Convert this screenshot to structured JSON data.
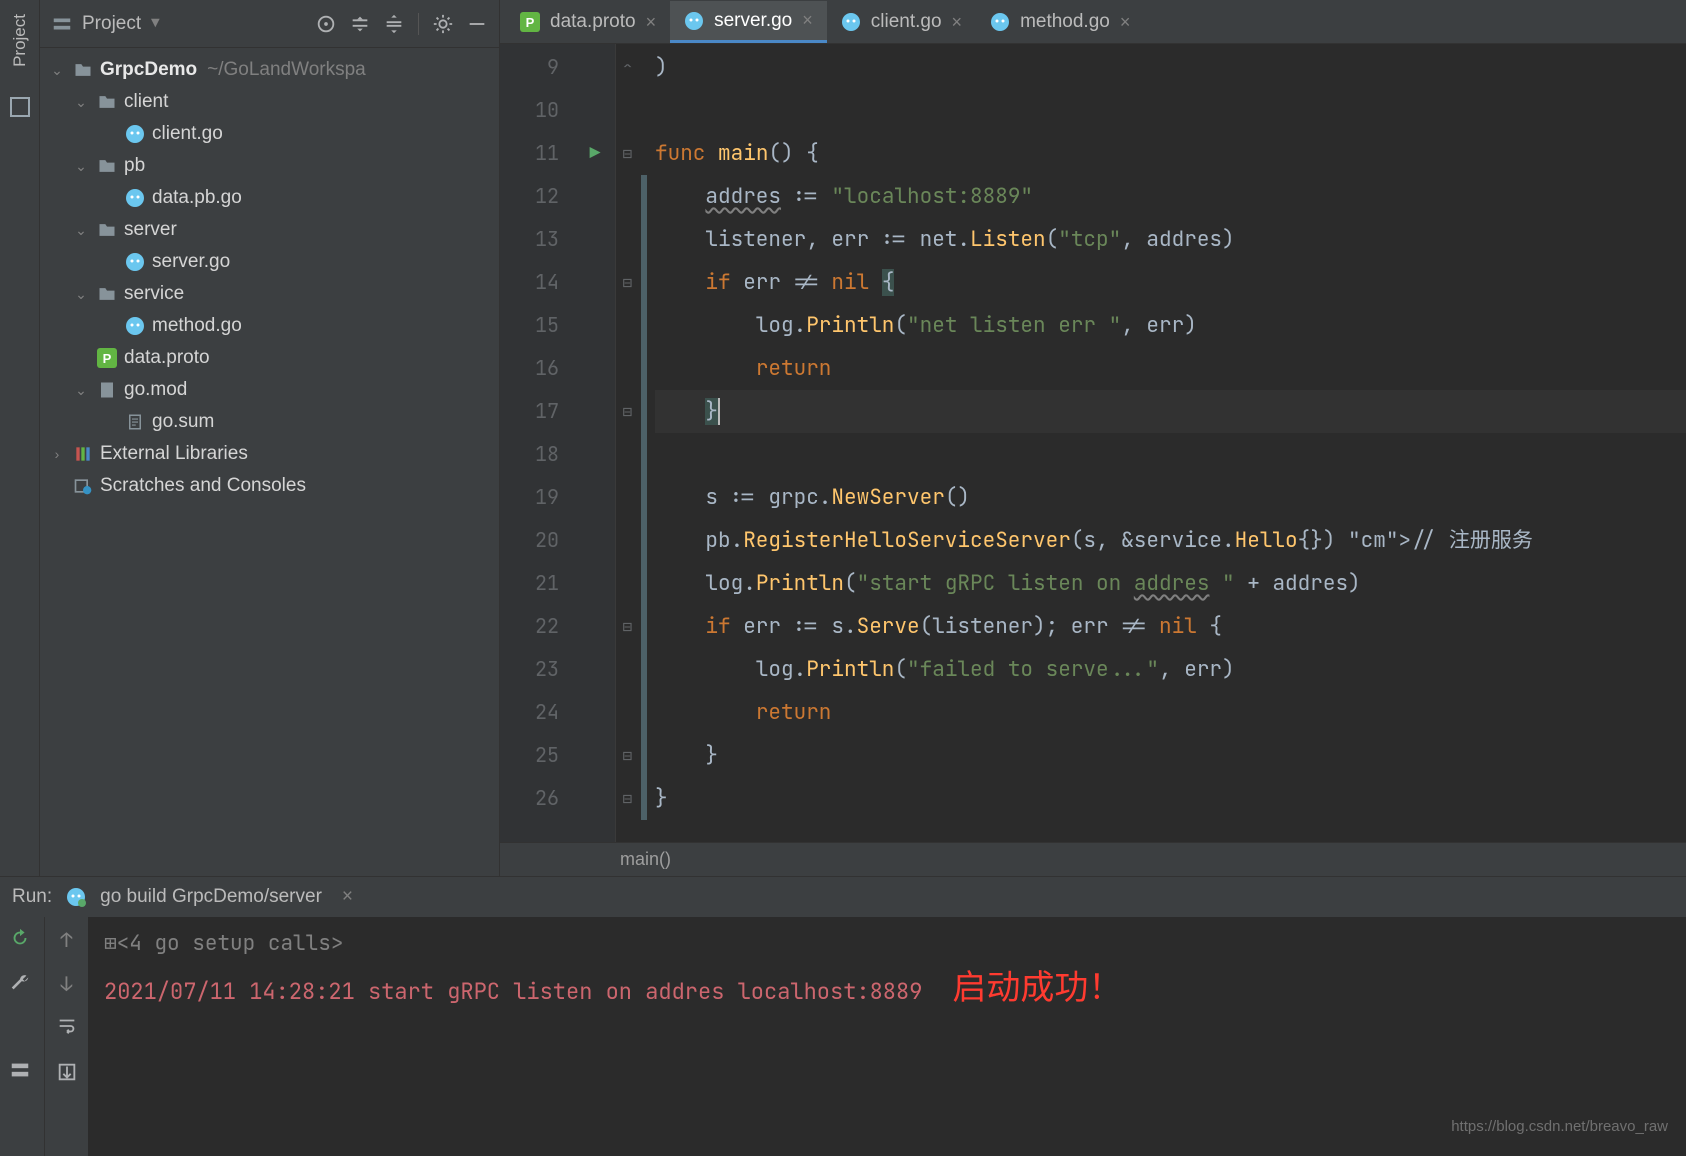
{
  "leftGutter": {
    "tabLabel": "Project"
  },
  "projectToolbar": {
    "title": "Project"
  },
  "tree": {
    "root": {
      "name": "GrpcDemo",
      "path": "~/GoLandWorkspa"
    },
    "client": {
      "name": "client",
      "file": "client.go"
    },
    "pb": {
      "name": "pb",
      "file": "data.pb.go"
    },
    "server": {
      "name": "server",
      "file": "server.go"
    },
    "service": {
      "name": "service",
      "file": "method.go"
    },
    "proto": "data.proto",
    "gomod": "go.mod",
    "gosum": "go.sum",
    "extLibs": "External Libraries",
    "scratches": "Scratches and Consoles"
  },
  "tabs": [
    {
      "label": "data.proto",
      "type": "proto"
    },
    {
      "label": "server.go",
      "type": "go",
      "active": true
    },
    {
      "label": "client.go",
      "type": "go"
    },
    {
      "label": "method.go",
      "type": "go"
    }
  ],
  "code": {
    "startLine": 9,
    "lines": [
      ")",
      "",
      "func main() {",
      "    addres := \"localhost:8889\"",
      "    listener, err := net.Listen(\"tcp\", addres)",
      "    if err != nil {",
      "        log.Println(\"net listen err \", err)",
      "        return",
      "    }",
      "",
      "    s := grpc.NewServer()",
      "    pb.RegisterHelloServiceServer(s, &service.Hello{}) // 注册服务",
      "    log.Println(\"start gRPC listen on addres \" + addres)",
      "    if err := s.Serve(listener); err != nil {",
      "        log.Println(\"failed to serve...\", err)",
      "        return",
      "    }",
      "}"
    ]
  },
  "breadcrumb": "main()",
  "run": {
    "label": "Run:",
    "config": "go build GrpcDemo/server",
    "collapsed": "<4 go setup calls>",
    "logLine": "2021/07/11 14:28:21 start gRPC listen on addres localhost:8889",
    "banner": "启动成功！",
    "watermark": "https://blog.csdn.net/breavo_raw"
  }
}
